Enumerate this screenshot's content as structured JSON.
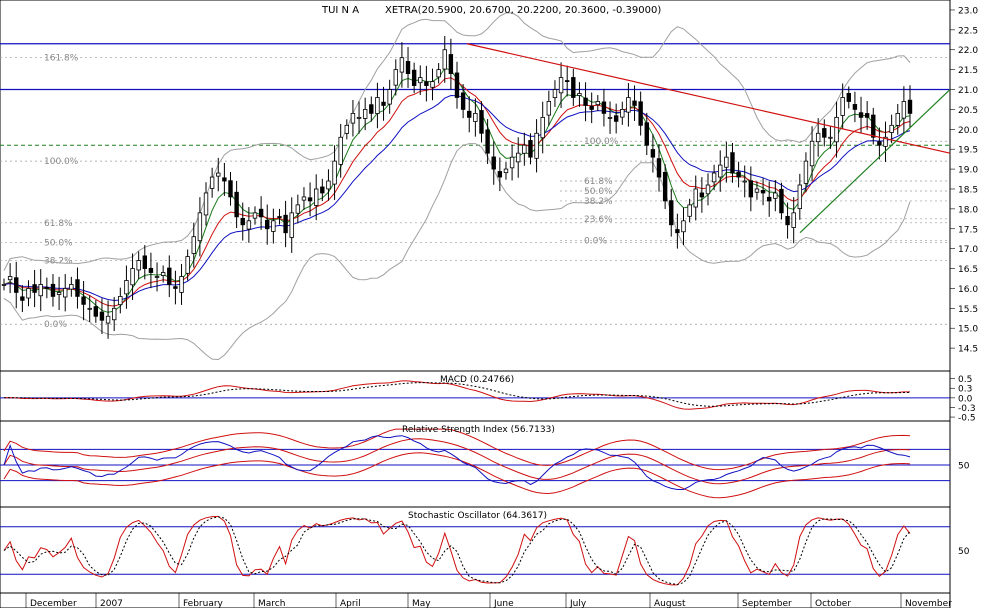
{
  "chart_data": {
    "type": "candlestick",
    "header": {
      "symbol": "TUI N A",
      "quote": "XETRA(20.5900, 20.6700, 20.2200, 20.3600, -0.39000)"
    },
    "x_months": [
      "December",
      "2007",
      "February",
      "March",
      "April",
      "May",
      "June",
      "July",
      "August",
      "September",
      "October",
      "November"
    ],
    "price_panel": {
      "y_ticks": [
        14.5,
        15.0,
        15.5,
        16.0,
        16.5,
        17.0,
        17.5,
        18.0,
        18.5,
        19.0,
        19.5,
        20.0,
        20.5,
        21.0,
        21.5,
        22.0,
        22.5,
        23.0
      ],
      "y_range": [
        14.0,
        23.2
      ],
      "horizontal_lines": [
        {
          "value": 22.15,
          "color": "#1010c0"
        },
        {
          "value": 21.0,
          "color": "#1010c0"
        },
        {
          "value": 19.6,
          "color": "#208020",
          "dashed": true
        }
      ],
      "fib_left": [
        {
          "label": "161.8%",
          "value": 21.8
        },
        {
          "label": "100.0%",
          "value": 19.2
        },
        {
          "label": "61.8%",
          "value": 17.65
        },
        {
          "label": "50.0%",
          "value": 17.15
        },
        {
          "label": "38.2%",
          "value": 16.7
        },
        {
          "label": "0.0%",
          "value": 15.1
        }
      ],
      "fib_right": [
        {
          "label": "100.0%",
          "value": 19.7
        },
        {
          "label": "61.8%",
          "value": 18.7
        },
        {
          "label": "50.0%",
          "value": 18.45
        },
        {
          "label": "38.2%",
          "value": 18.2
        },
        {
          "label": "23.6%",
          "value": 17.75
        },
        {
          "label": "0.0%",
          "value": 17.2
        }
      ],
      "trendlines": [
        {
          "color": "#d01010",
          "from": [
            "May",
            22.15
          ],
          "to": [
            "November",
            19.4
          ]
        },
        {
          "color": "#208020",
          "from": [
            "September",
            17.4
          ],
          "to": [
            "November",
            21.0
          ]
        }
      ],
      "close_series": [
        16.1,
        16.3,
        15.9,
        15.7,
        16.0,
        15.9,
        16.1,
        16.0,
        15.8,
        15.9,
        16.0,
        16.1,
        15.8,
        15.6,
        15.5,
        15.3,
        15.2,
        15.3,
        15.5,
        15.8,
        16.2,
        16.5,
        16.7,
        16.5,
        16.4,
        16.3,
        16.4,
        16.1,
        16.0,
        16.3,
        16.8,
        17.3,
        17.9,
        18.4,
        18.8,
        18.9,
        18.7,
        18.3,
        17.8,
        17.6,
        17.7,
        17.9,
        17.8,
        17.5,
        17.7,
        17.8,
        17.4,
        17.9,
        18.1,
        18.3,
        18.2,
        18.5,
        18.4,
        18.7,
        19.2,
        19.8,
        20.1,
        20.4,
        20.3,
        20.5,
        20.4,
        20.8,
        20.6,
        21.0,
        21.5,
        21.8,
        21.4,
        21.1,
        21.3,
        21.1,
        21.2,
        21.5,
        22.0,
        21.4,
        20.8,
        20.5,
        20.3,
        20.4,
        19.9,
        19.4,
        19.0,
        18.8,
        19.0,
        19.3,
        19.4,
        19.6,
        19.3,
        19.9,
        20.3,
        20.7,
        21.0,
        21.3,
        21.2,
        20.8,
        20.9,
        20.6,
        20.5,
        20.7,
        20.4,
        20.3,
        20.2,
        20.5,
        20.8,
        20.6,
        20.1,
        19.6,
        19.3,
        18.8,
        18.2,
        17.6,
        17.4,
        17.7,
        18.1,
        18.5,
        18.3,
        18.6,
        18.9,
        19.1,
        19.3,
        18.9,
        18.8,
        18.7,
        18.3,
        18.5,
        18.4,
        18.2,
        18.4,
        17.9,
        17.6,
        17.9,
        18.6,
        19.2,
        19.7,
        19.9,
        19.8,
        19.8,
        20.3,
        20.8,
        20.7,
        20.5,
        20.3,
        20.3,
        19.8,
        19.6,
        19.8,
        20.1,
        20.4,
        20.7,
        20.4
      ]
    },
    "macd_panel": {
      "label": "MACD (0.24766)",
      "y_ticks": [
        0.5,
        0.25,
        0.0,
        -0.25,
        -0.5
      ],
      "y_tick_labels": [
        "0.5",
        "0.3",
        "0.0",
        "-0.3",
        "-0.5"
      ],
      "y_range": [
        -0.55,
        0.62
      ],
      "zero_line": 0.0
    },
    "rsi_panel": {
      "label": "Relative Strength Index (56.7133)",
      "y_ticks": [
        50
      ],
      "y_range": [
        0,
        100
      ],
      "lines": [
        70,
        50,
        30
      ]
    },
    "stoch_panel": {
      "label": "Stochastic Oscillator (64.3617)",
      "y_ticks": [
        50
      ],
      "y_range": [
        0,
        100
      ],
      "lines": [
        80,
        20
      ]
    },
    "colors": {
      "price_bars": "#000000",
      "ma_short": "#1a7a1a",
      "ma_mid": "#d01010",
      "ma_long": "#1010c0",
      "bands": "#a0a0a0",
      "indicator_main": "#d01010",
      "indicator_signal": "#000000",
      "rsi": "#1010c0",
      "level_lines": "#1010c0"
    }
  }
}
